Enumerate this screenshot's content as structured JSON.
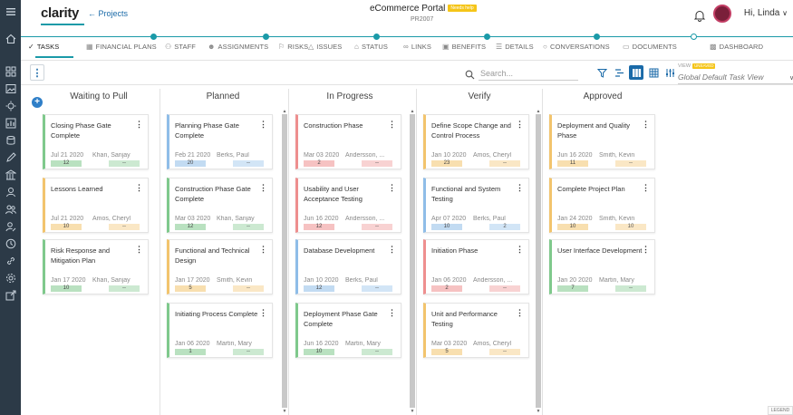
{
  "app": {
    "logo": "clarity",
    "back_link": "← Projects",
    "project_title": "eCommerce Portal",
    "project_status_badge": "Needs help",
    "project_id": "PR2007",
    "greeting": "Hi, Linda"
  },
  "tabs": [
    {
      "label": "TASKS",
      "icon": "check-icon"
    },
    {
      "label": "FINANCIAL PLANS",
      "icon": "finance-icon"
    },
    {
      "label": "STAFF",
      "icon": "staff-icon"
    },
    {
      "label": "ASSIGNMENTS",
      "icon": "assignments-icon"
    },
    {
      "label": "RISKS",
      "icon": "flag-icon"
    },
    {
      "label": "ISSUES",
      "icon": "warning-icon"
    },
    {
      "label": "STATUS",
      "icon": "status-icon"
    },
    {
      "label": "LINKS",
      "icon": "link-icon"
    },
    {
      "label": "BENEFITS",
      "icon": "benefits-icon"
    },
    {
      "label": "DETAILS",
      "icon": "details-icon"
    },
    {
      "label": "CONVERSATIONS",
      "icon": "chat-icon"
    },
    {
      "label": "DOCUMENTS",
      "icon": "folder-icon"
    },
    {
      "label": "DASHBOARD",
      "icon": "dashboard-icon"
    }
  ],
  "toolbar": {
    "search_placeholder": "Search...",
    "view_label": "VIEW",
    "view_unsaved": "UNSAVED",
    "view_name": "Global Default Task View"
  },
  "columns": [
    {
      "name": "Waiting to Pull",
      "cards": [
        {
          "title": "Closing Phase Gate Complete",
          "date": "Jul 21 2020",
          "owner": "Khan, Sanjay",
          "count": "12",
          "extra": "--",
          "color": "#7fc98c"
        },
        {
          "title": "Lessons Learned",
          "date": "Jul 21 2020",
          "owner": "Amos, Cheryl",
          "count": "10",
          "extra": "--",
          "color": "#f2c46d"
        },
        {
          "title": "Risk Response and Mitigation Plan",
          "date": "Jan 17 2020",
          "owner": "Khan, Sanjay",
          "count": "10",
          "extra": "--",
          "color": "#7fc98c"
        }
      ]
    },
    {
      "name": "Planned",
      "cards": [
        {
          "title": "Planning Phase Gate Complete",
          "date": "Feb 21 2020",
          "owner": "Berks, Paul",
          "count": "20",
          "extra": "--",
          "color": "#8fbde8"
        },
        {
          "title": "Construction Phase Gate Complete",
          "date": "Mar 03 2020",
          "owner": "Khan, Sanjay",
          "count": "12",
          "extra": "--",
          "color": "#7fc98c"
        },
        {
          "title": "Functional and Technical Design",
          "date": "Jan 17 2020",
          "owner": "Smith, Kevin",
          "count": "5",
          "extra": "--",
          "color": "#f2c46d"
        },
        {
          "title": "Initiating Process Complete",
          "date": "Jan 06 2020",
          "owner": "Martin, Mary",
          "count": "1",
          "extra": "--",
          "color": "#7fc98c"
        }
      ]
    },
    {
      "name": "In Progress",
      "cards": [
        {
          "title": "Construction Phase",
          "date": "Mar 03 2020",
          "owner": "Andersson, ...",
          "count": "2",
          "extra": "--",
          "color": "#ee8f8f"
        },
        {
          "title": "Usability and User Acceptance Testing",
          "date": "Jun 16 2020",
          "owner": "Andersson, ...",
          "count": "12",
          "extra": "--",
          "color": "#ee8f8f"
        },
        {
          "title": "Database Development",
          "date": "Jan 10 2020",
          "owner": "Berks, Paul",
          "count": "12",
          "extra": "--",
          "color": "#8fbde8"
        },
        {
          "title": "Deployment Phase Gate Complete",
          "date": "Jun 16 2020",
          "owner": "Martin, Mary",
          "count": "10",
          "extra": "--",
          "color": "#7fc98c"
        }
      ]
    },
    {
      "name": "Verify",
      "cards": [
        {
          "title": "Define Scope Change and Control Process",
          "date": "Jan 10 2020",
          "owner": "Amos, Cheryl",
          "count": "23",
          "extra": "--",
          "color": "#f2c46d"
        },
        {
          "title": "Functional and System Testing",
          "date": "Apr 07 2020",
          "owner": "Berks, Paul",
          "count": "10",
          "extra": "2",
          "color": "#8fbde8"
        },
        {
          "title": "Initiation Phase",
          "date": "Jan 06 2020",
          "owner": "Andersson, ...",
          "count": "2",
          "extra": "--",
          "color": "#ee8f8f"
        },
        {
          "title": "Unit and Performance Testing",
          "date": "Mar 03 2020",
          "owner": "Amos, Cheryl",
          "count": "5",
          "extra": "--",
          "color": "#f2c46d"
        }
      ]
    },
    {
      "name": "Approved",
      "cards": [
        {
          "title": "Deployment and Quality Phase",
          "date": "Jun 16 2020",
          "owner": "Smith, Kevin",
          "count": "11",
          "extra": "--",
          "color": "#f2c46d"
        },
        {
          "title": "Complete Project Plan",
          "date": "Jan 24 2020",
          "owner": "Smith, Kevin",
          "count": "10",
          "extra": "10",
          "color": "#f2c46d"
        },
        {
          "title": "User Interface Development",
          "date": "Jan 20 2020",
          "owner": "Martin, Mary",
          "count": "7",
          "extra": "--",
          "color": "#7fc98c"
        }
      ]
    }
  ],
  "legend_tab": "LEGEND",
  "colors": {
    "accent": "#1b9aa8",
    "rail": "#2c3a47",
    "link": "#1a6aa8",
    "green": "#7fc98c",
    "yellow": "#f2c46d",
    "red": "#ee8f8f",
    "blue": "#8fbde8"
  }
}
